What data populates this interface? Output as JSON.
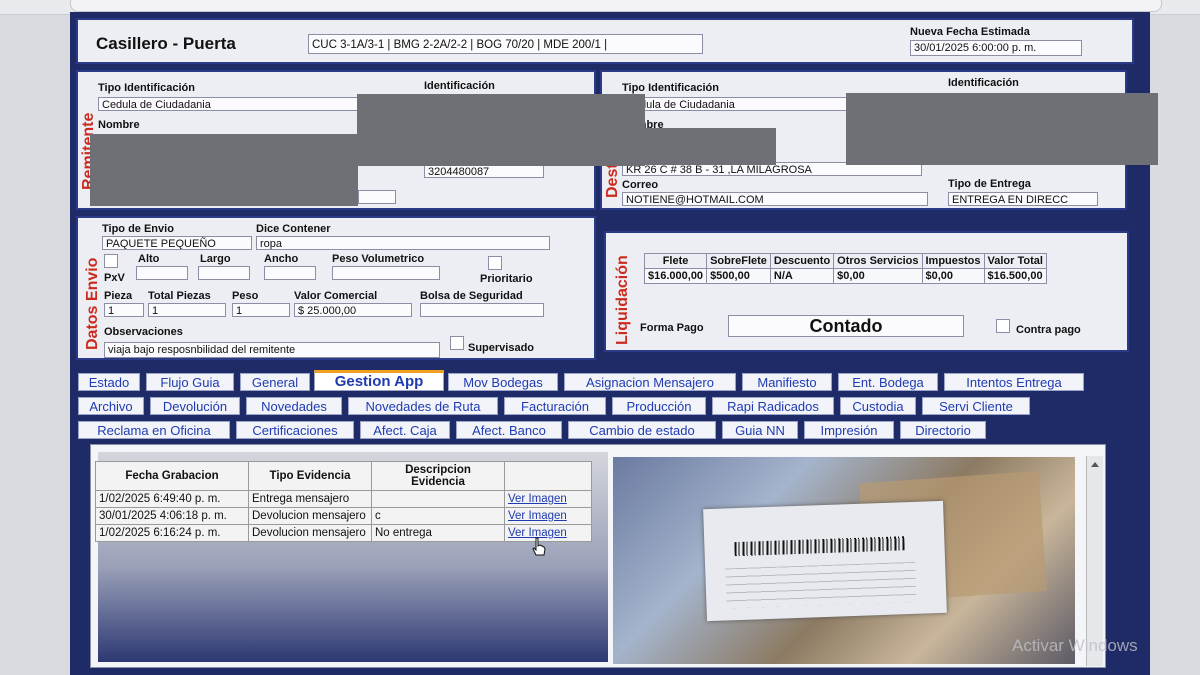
{
  "header": {
    "title": "Casillero - Puerta",
    "route": "CUC 3-1A/3-1 | BMG 2-2A/2-2 | BOG 70/20 | MDE 200/1 |",
    "fecha_label": "Nueva Fecha Estimada",
    "fecha_value": "30/01/2025 6:00:00 p. m."
  },
  "remitente": {
    "section_label": "Remitente",
    "tipo_id_label": "Tipo Identificación",
    "tipo_id_value": "Cedula de Ciudadania",
    "id_label": "Identificación",
    "nombre_label": "Nombre",
    "phone_value": "3204480087"
  },
  "destinatario": {
    "section_label": "Destinatario",
    "tipo_id_label": "Tipo Identificación",
    "tipo_id_value": "Cedula de Ciudadania",
    "id_label": "Identificación",
    "nombre_label": "Nombre",
    "direccion_value": "KR 26 C # 38 B - 31 ,LA MILAGROSA",
    "correo_label": "Correo",
    "correo_value": "NOTIENE@HOTMAIL.COM",
    "tipo_entrega_label": "Tipo de Entrega",
    "tipo_entrega_value": "ENTREGA EN DIRECC"
  },
  "envio": {
    "section_label": "Datos Envio",
    "tipo_envio_label": "Tipo de Envio",
    "tipo_envio_value": "PAQUETE PEQUEÑO",
    "dice_contener_label": "Dice Contener",
    "dice_contener_value": "ropa",
    "alto_label": "Alto",
    "largo_label": "Largo",
    "ancho_label": "Ancho",
    "peso_vol_label": "Peso Volumetrico",
    "pxv_label": "PxV",
    "prioritario_label": "Prioritario",
    "pieza_label": "Pieza",
    "pieza_value": "1",
    "total_piezas_label": "Total Piezas",
    "total_piezas_value": "1",
    "peso_label": "Peso",
    "peso_value": "1",
    "valor_comercial_label": "Valor Comercial",
    "valor_comercial_value": "$ 25.000,00",
    "bolsa_label": "Bolsa de Seguridad",
    "observaciones_label": "Observaciones",
    "observaciones_value": "viaja bajo resposnbilidad del remitente",
    "supervisado_label": "Supervisado"
  },
  "liquidacion": {
    "section_label": "Liquidación",
    "headers": [
      "Flete",
      "SobreFlete",
      "Descuento",
      "Otros Servicios",
      "Impuestos",
      "Valor Total"
    ],
    "values": [
      "$16.000,00",
      "$500,00",
      "N/A",
      "$0,00",
      "$0,00",
      "$16.500,00"
    ],
    "forma_pago_label": "Forma Pago",
    "forma_pago_value": "Contado",
    "contra_pago_label": "Contra pago"
  },
  "tabs": {
    "row1": [
      "Estado",
      "Flujo Guia",
      "General",
      "Gestion App",
      "Mov Bodegas",
      "Asignacion Mensajero",
      "Manifiesto",
      "Ent. Bodega",
      "Intentos Entrega"
    ],
    "row2": [
      "Archivo",
      "Devolución",
      "Novedades",
      "Novedades de Ruta",
      "Facturación",
      "Producción",
      "Rapi Radicados",
      "Custodia",
      "Servi Cliente"
    ],
    "row3": [
      "Reclama en Oficina",
      "Certificaciones",
      "Afect. Caja",
      "Afect. Banco",
      "Cambio de estado",
      "Guia NN",
      "Impresión",
      "Directorio"
    ]
  },
  "evidencias": {
    "headers": [
      "Fecha Grabacion",
      "Tipo Evidencia",
      "Descripcion Evidencia",
      ""
    ],
    "rows": [
      {
        "fecha": "1/02/2025 6:49:40 p. m.",
        "tipo": "Entrega mensajero",
        "descripcion": "",
        "link": "Ver Imagen"
      },
      {
        "fecha": "30/01/2025 4:06:18 p. m.",
        "tipo": "Devolucion mensajero",
        "descripcion": "c",
        "link": "Ver Imagen"
      },
      {
        "fecha": "1/02/2025 6:16:24 p. m.",
        "tipo": "Devolucion mensajero",
        "descripcion": "No entrega",
        "link": "Ver Imagen"
      }
    ]
  },
  "watermark": "Activar Windows"
}
